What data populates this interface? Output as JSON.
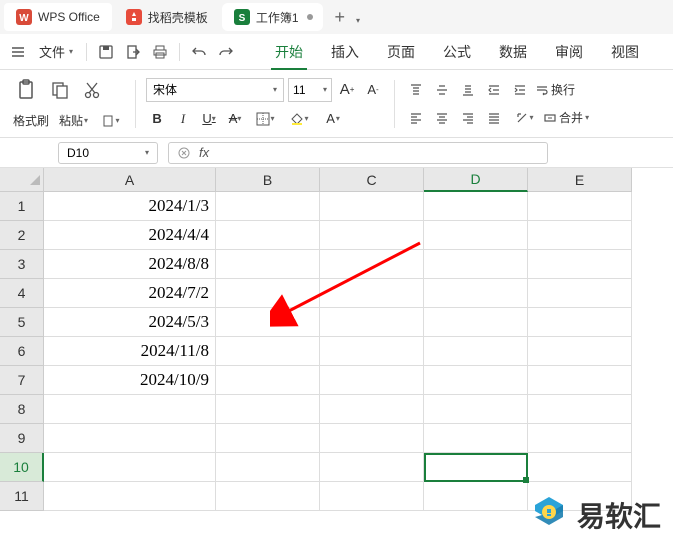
{
  "titlebar": {
    "app_name": "WPS Office",
    "template_tab": "找稻壳模板",
    "doc_tab": "工作簿1",
    "plus": "+"
  },
  "menu": {
    "file": "文件",
    "tabs": [
      "开始",
      "插入",
      "页面",
      "公式",
      "数据",
      "审阅",
      "视图"
    ]
  },
  "toolbar": {
    "format_brush": "格式刷",
    "paste": "粘贴",
    "font_name": "宋体",
    "font_size": "11",
    "wrap": "换行",
    "merge": "合并"
  },
  "namebox": {
    "ref": "D10"
  },
  "grid": {
    "cols": [
      "A",
      "B",
      "C",
      "D",
      "E"
    ],
    "rows": [
      "1",
      "2",
      "3",
      "4",
      "5",
      "6",
      "7",
      "8",
      "9",
      "10",
      "11"
    ],
    "data": {
      "A1": "2024/1/3",
      "A2": "2024/4/4",
      "A3": "2024/8/8",
      "A4": "2024/7/2",
      "A5": "2024/5/3",
      "A6": "2024/11/8",
      "A7": "2024/10/9"
    },
    "selected": "D10"
  },
  "watermark": {
    "text": "易软汇"
  }
}
